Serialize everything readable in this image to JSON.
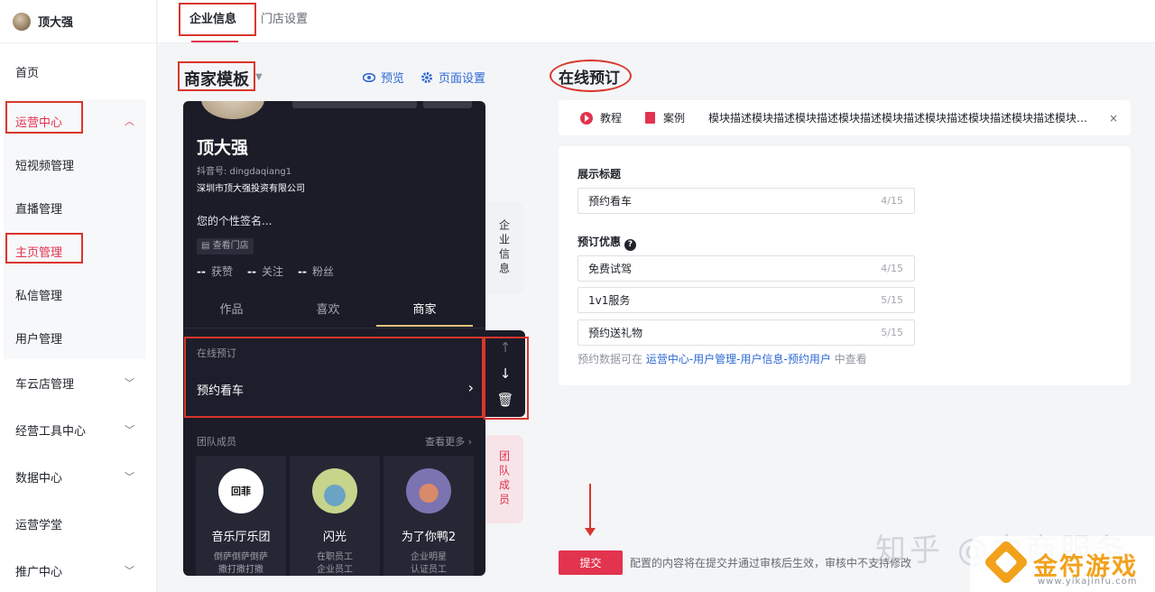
{
  "user": {
    "name": "顶大强"
  },
  "sidebar": {
    "items": [
      {
        "label": "首页"
      },
      {
        "label": "运营中心"
      },
      {
        "label": "短视频管理"
      },
      {
        "label": "直播管理"
      },
      {
        "label": "主页管理"
      },
      {
        "label": "私信管理"
      },
      {
        "label": "用户管理"
      },
      {
        "label": "车云店管理"
      },
      {
        "label": "经营工具中心"
      },
      {
        "label": "数据中心"
      },
      {
        "label": "运营学堂"
      },
      {
        "label": "推广中心"
      }
    ]
  },
  "tabs": [
    {
      "label": "企业信息",
      "active": true
    },
    {
      "label": "门店设置",
      "active": false
    }
  ],
  "editor": {
    "template_title": "商家模板",
    "preview_label": "预览",
    "page_settings_label": "页面设置"
  },
  "phone": {
    "name": "顶大强",
    "douyin_id": "抖音号: dingdaqiang1",
    "company": "深圳市顶大强投资有限公司",
    "signature": "您的个性签名...",
    "view_store": "查看门店",
    "stats": [
      {
        "value": "--",
        "label": "获赞"
      },
      {
        "value": "--",
        "label": "关注"
      },
      {
        "value": "--",
        "label": "粉丝"
      }
    ],
    "tabs": [
      "作品",
      "喜欢",
      "商家"
    ],
    "booking_label": "在线预订",
    "booking_item": "预约看车",
    "team_label": "团队成员",
    "team_more": "查看更多",
    "members": [
      {
        "name": "音乐厅乐团",
        "desc1": "倒萨倒萨倒萨",
        "desc2": "撒打撒打撒",
        "logo": "回菲"
      },
      {
        "name": "闪光",
        "desc1": "在职员工",
        "desc2": "企业员工"
      },
      {
        "name": "为了你鸭2",
        "desc1": "企业明星",
        "desc2": "认证员工"
      }
    ]
  },
  "side_tabs": {
    "company_info": "企业信息",
    "team": "团队成员"
  },
  "right_panel": {
    "title": "在线预订",
    "notice": {
      "tutorial": "教程",
      "case": "案例",
      "desc": "模块描述模块描述模块描述模块描述模块描述模块描述模块描述模块描述模块描述",
      "close": "×"
    },
    "display_title_label": "展示标题",
    "display_title": {
      "value": "预约看车",
      "count": "4/15"
    },
    "offer_label": "预订优惠",
    "offers": [
      {
        "value": "免费试驾",
        "count": "4/15"
      },
      {
        "value": "1v1服务",
        "count": "5/15"
      },
      {
        "value": "预约送礼物",
        "count": "5/15"
      }
    ],
    "hint_prefix": "预约数据可在 ",
    "hint_link": "运营中心-用户管理-用户信息-预约用户",
    "hint_suffix": " 中查看"
  },
  "footer": {
    "submit": "提交",
    "note": "配置的内容将在提交并通过审核后生效，审核中不支持修改"
  },
  "watermark": {
    "zhihu": "知乎 @中商服务",
    "brand": "金符游戏",
    "url": "www.yikajinfu.com"
  }
}
